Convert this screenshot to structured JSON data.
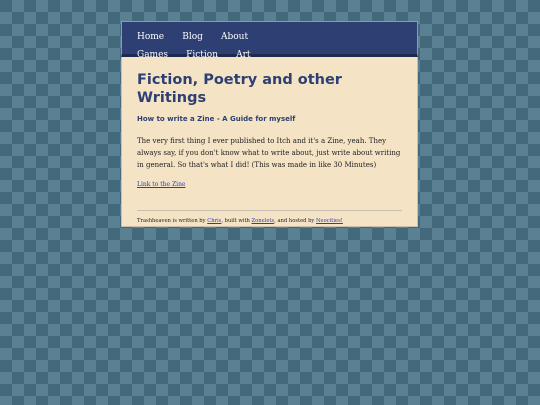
{
  "nav": {
    "items": [
      {
        "label": "Home"
      },
      {
        "label": "Blog"
      },
      {
        "label": "About"
      },
      {
        "label": "Games"
      },
      {
        "label": "Fiction"
      },
      {
        "label": "Art"
      }
    ]
  },
  "main": {
    "title": "Fiction, Poetry and other Writings",
    "subtitle": "How to write a Zine - A Guide for myself",
    "body": "The very first thing I ever published to Itch and it's a Zine, yeah. They always say, if you don't know what to write about, just write about writing in general. So that's what I did! (This was made in like 30 Minutes)",
    "link_text": "Link to the Zine"
  },
  "footer": {
    "prefix": "Trashheaven is written by ",
    "author_link": "Chris",
    "middle": ", built with ",
    "zonelets_link": "Zonelets",
    "middle2": ", and hosted by ",
    "host_link": "Neocities!"
  },
  "colors": {
    "background": "#44697a",
    "background_pattern": "#5a8193",
    "nav_bg": "#2d3f73",
    "content_bg": "#f4e3c4",
    "heading": "#2d3f73",
    "link": "#2b3fb0"
  }
}
